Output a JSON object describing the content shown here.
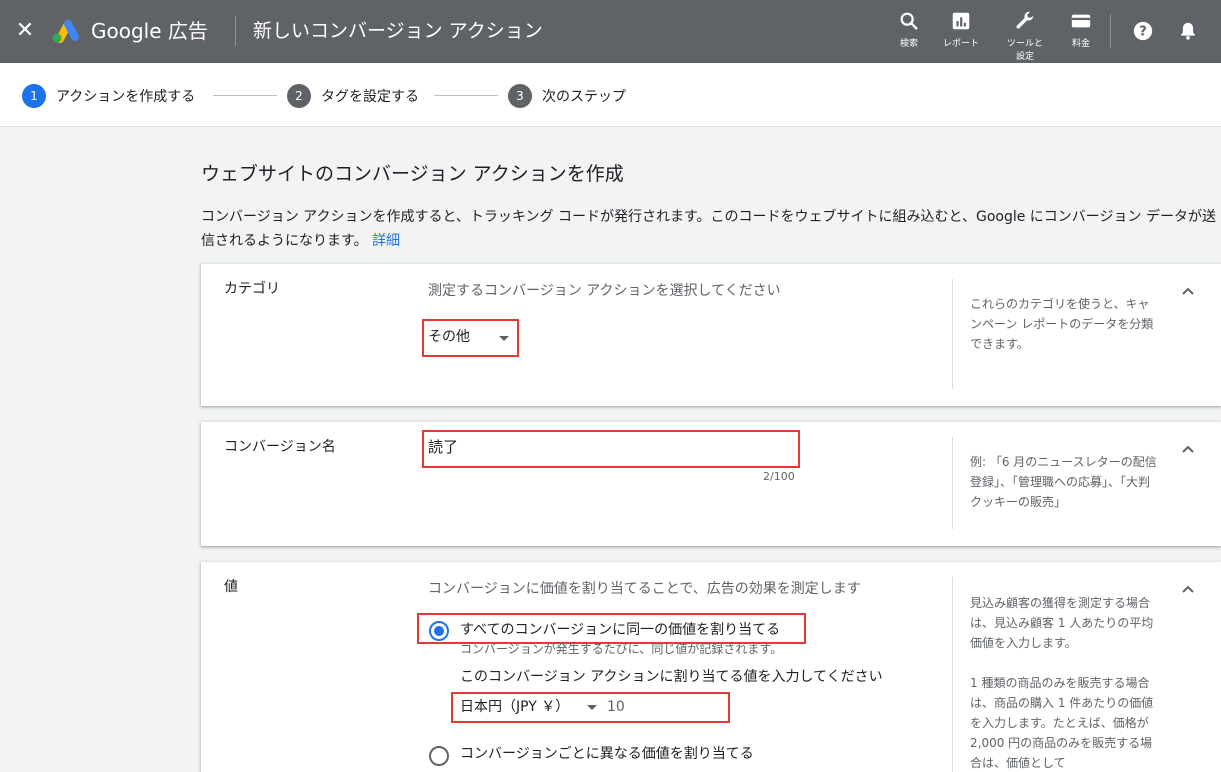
{
  "topbar": {
    "close_icon": "close-icon",
    "brand": "Google 広告",
    "title": "新しいコンバージョン アクション",
    "tools": [
      {
        "label": "検索",
        "icon": "search-icon"
      },
      {
        "label": "レポート",
        "icon": "bar-chart-icon"
      },
      {
        "label": "ツールと設定",
        "icon": "wrench-icon"
      },
      {
        "label": "料金",
        "icon": "credit-card-icon"
      }
    ],
    "help_icon": "help-icon",
    "bell_icon": "bell-icon"
  },
  "stepper": {
    "steps": [
      {
        "number": "1",
        "label": "アクションを作成する",
        "state": "active"
      },
      {
        "number": "2",
        "label": "タグを設定する",
        "state": "pending"
      },
      {
        "number": "3",
        "label": "次のステップ",
        "state": "pending"
      }
    ]
  },
  "main": {
    "heading": "ウェブサイトのコンバージョン アクションを作成",
    "intro": "コンバージョン アクションを作成すると、トラッキング コードが発行されます。このコードをウェブサイトに組み込むと、Google にコンバージョン データが送信されるようになります。",
    "learn_more": "詳細"
  },
  "category": {
    "label": "カテゴリ",
    "hint": "測定するコンバージョン アクションを選択してください",
    "selected": "その他",
    "help": "これらのカテゴリを使うと、キャンペーン レポートのデータを分類できます。"
  },
  "conversion_name": {
    "label": "コンバージョン名",
    "value": "読了",
    "counter": "2/100",
    "help": "例: 「6 月のニュースレターの配信登録」、「管理職への応募」、「大判クッキーの販売」"
  },
  "value": {
    "label": "値",
    "hint": "コンバージョンに価値を割り当てることで、広告の効果を測定します",
    "option_same": "すべてのコンバージョンに同一の価値を割り当てる",
    "option_same_sub": "コンバージョンが発生するたびに、同じ値が記録されます。",
    "prompt": "このコンバージョン アクションに割り当てる値を入力してください",
    "currency": "日本円（JPY ￥）",
    "amount": "10",
    "option_different": "コンバージョンごとに異なる価値を割り当てる",
    "help": "見込み顧客の獲得を測定する場合は、見込み顧客 1 人あたりの平均価値を入力します。\n\n1 種類の商品のみを販売する場合は、商品の購入 1 件あたりの価値を入力します。たとえば、価格が 2,000 円の商品のみを販売する場合は、価値として"
  },
  "colors": {
    "topbar": "#5f6368",
    "accent": "#1a73e8",
    "highlight": "#e53935"
  }
}
